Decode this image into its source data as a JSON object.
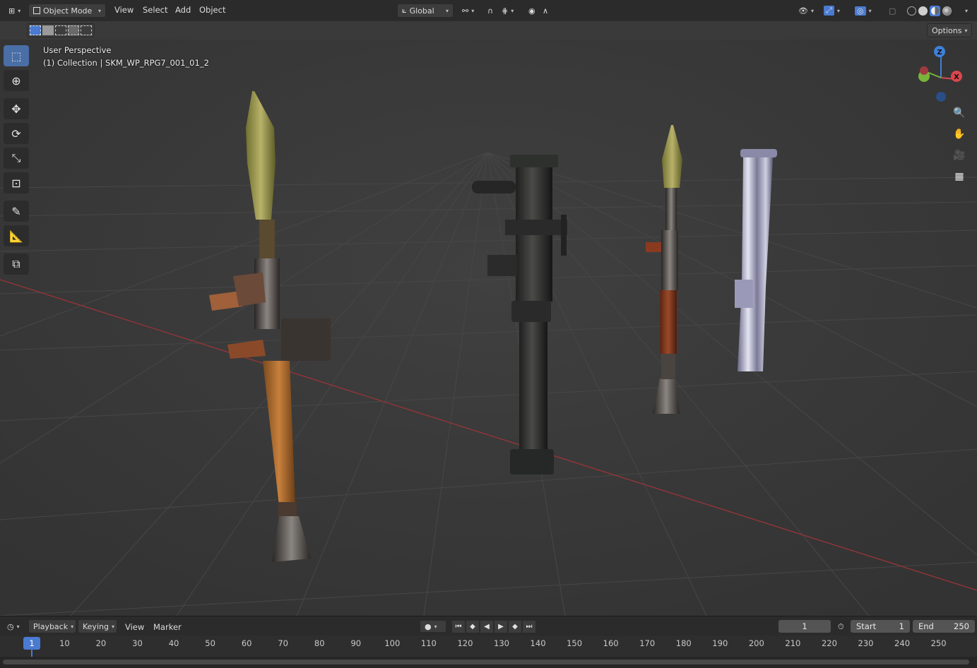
{
  "header": {
    "mode_label": "Object Mode",
    "menus": [
      "View",
      "Select",
      "Add",
      "Object"
    ],
    "transform_orientation": "Global",
    "options_label": "Options"
  },
  "viewport": {
    "perspective_label": "User Perspective",
    "collection_label": "(1) Collection | SKM_WP_RPG7_001_01_2",
    "gizmo": {
      "z": "Z",
      "x": "X"
    }
  },
  "timeline": {
    "menus": [
      "Playback",
      "Keying",
      "View",
      "Marker"
    ],
    "current_frame": "1",
    "start_label": "Start",
    "start_value": "1",
    "end_label": "End",
    "end_value": "250",
    "ruler_ticks": [
      "1",
      "10",
      "20",
      "30",
      "40",
      "50",
      "60",
      "70",
      "80",
      "90",
      "100",
      "110",
      "120",
      "130",
      "140",
      "150",
      "160",
      "170",
      "180",
      "190",
      "200",
      "210",
      "220",
      "230",
      "240",
      "250"
    ]
  },
  "icons": {
    "select_box": "select-box-icon",
    "cursor": "cursor-icon",
    "move": "move-icon",
    "rotate": "rotate-icon",
    "scale": "scale-icon",
    "transform": "transform-icon",
    "annotate": "annotate-icon",
    "measure": "measure-icon",
    "add_cube": "add-cube-icon"
  },
  "colors": {
    "accent": "#4a7bd1",
    "x_axis": "#d8474d",
    "y_axis": "#7ab33c",
    "z_axis": "#3f80d8",
    "viewport_bg": "#3a3a3a"
  }
}
